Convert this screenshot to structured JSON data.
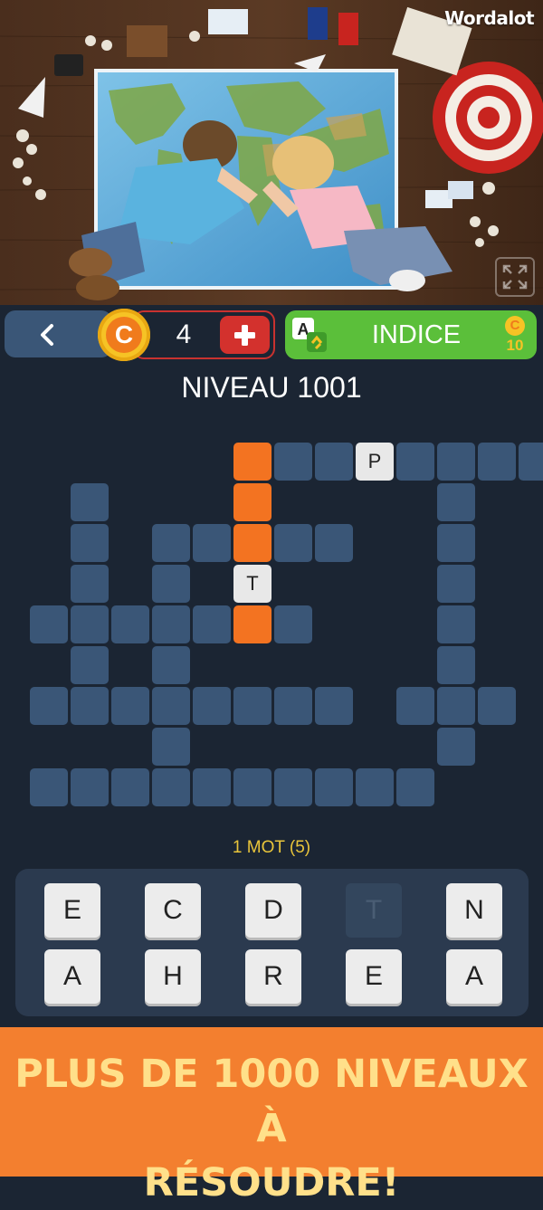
{
  "brand": {
    "name": "Wordalot"
  },
  "toolbar": {
    "coin_count": "4",
    "hint_label": "INDICE",
    "hint_cost": "10",
    "coin_symbol": "C"
  },
  "level": {
    "title": "NIVEAU 1001"
  },
  "grid": {
    "revealed_letters": [
      "P",
      "T"
    ]
  },
  "word_hint": "1 MOT (5)",
  "letter_tray": {
    "row1": [
      "E",
      "C",
      "D",
      "T",
      "N"
    ],
    "row2": [
      "A",
      "H",
      "R",
      "E",
      "A"
    ],
    "used_letter": "T"
  },
  "banner": {
    "line1": "PLUS DE 1000 NIVEAUX À",
    "line2": "RÉSOUDRE!"
  },
  "colors": {
    "background": "#1b2533",
    "cell": "#3a5677",
    "highlight": "#f37321",
    "hint_button": "#5bbf3a",
    "banner": "#f37f2f",
    "banner_text": "#ffe08a"
  },
  "icons": [
    "back-arrow-icon",
    "coin-icon",
    "plus-icon",
    "hint-swap-icon",
    "expand-icon"
  ]
}
